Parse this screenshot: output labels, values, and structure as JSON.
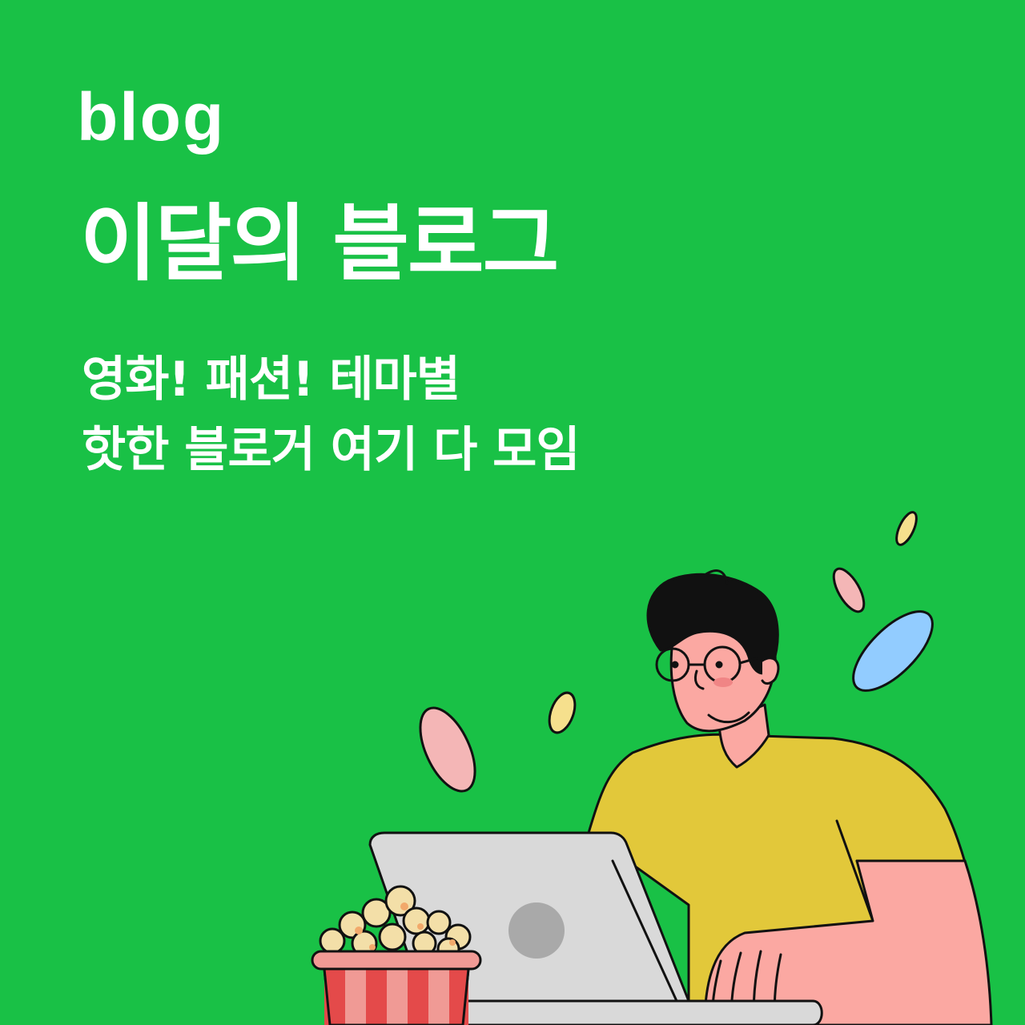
{
  "brand": {
    "logo_text": "blog",
    "bg_color": "#19c146"
  },
  "headline": {
    "title": "이달의 블로그"
  },
  "subheadline": {
    "line1": "영화! 패션! 테마별",
    "line2": "핫한 블로거 여기 다 모임"
  }
}
